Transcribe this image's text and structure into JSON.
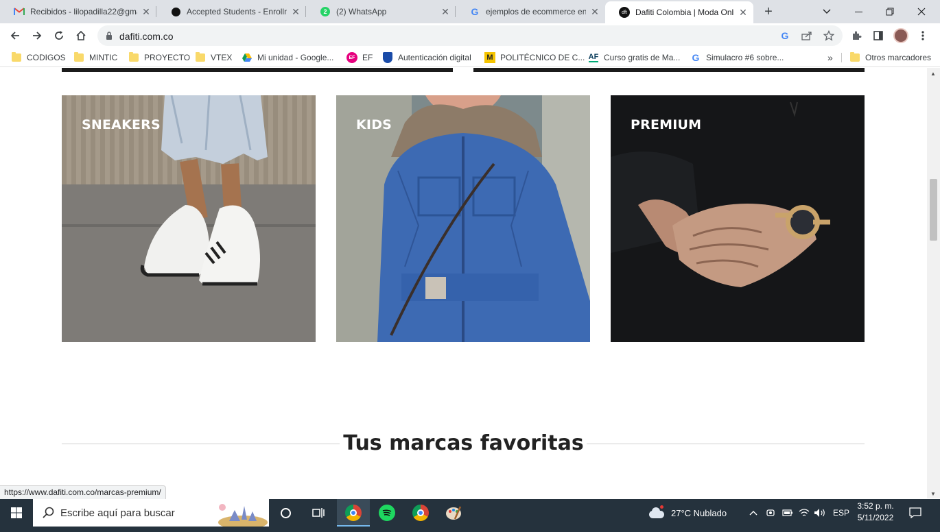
{
  "browser": {
    "tabs": [
      {
        "title": "Recibidos - lilopadilla22@gmail.com",
        "icon": "gmail-icon"
      },
      {
        "title": "Accepted Students - Enrollment",
        "icon": "dot-icon"
      },
      {
        "title": "(2) WhatsApp",
        "icon": "whatsapp-icon"
      },
      {
        "title": "ejemplos de ecommerce en colombia",
        "icon": "google-icon"
      },
      {
        "title": "Dafiti Colombia | Moda Online",
        "icon": "dafiti-icon"
      }
    ],
    "active_tab": 4,
    "url": "dafiti.com.co",
    "bookmarks": [
      {
        "label": "CODIGOS",
        "icon": "folder-icon"
      },
      {
        "label": "MINTIC",
        "icon": "folder-icon"
      },
      {
        "label": "PROYECTO",
        "icon": "folder-icon"
      },
      {
        "label": "VTEX",
        "icon": "folder-icon"
      },
      {
        "label": "Mi unidad - Google...",
        "icon": "google-drive-icon"
      },
      {
        "label": "EF",
        "icon": "ef-icon"
      },
      {
        "label": "Autenticación digital",
        "icon": "shield-icon"
      },
      {
        "label": "POLITÉCNICO DE C...",
        "icon": "m-icon"
      },
      {
        "label": "Curso gratis de Ma...",
        "icon": "af-icon"
      },
      {
        "label": "Simulacro #6 sobre...",
        "icon": "google-icon"
      }
    ],
    "bookmarks_overflow": "»",
    "other_bookmarks": "Otros marcadores",
    "status_url": "https://www.dafiti.com.co/marcas-premium/"
  },
  "page": {
    "categories": [
      {
        "label": "SNEAKERS"
      },
      {
        "label": "KIDS"
      },
      {
        "label": "PREMIUM"
      }
    ],
    "section_title": "Tus marcas favoritas"
  },
  "taskbar": {
    "search_placeholder": "Escribe aquí para buscar",
    "weather": "27°C  Nublado",
    "language": "ESP",
    "time": "3:52 p. m.",
    "date": "5/11/2022"
  },
  "colors": {
    "tabbar": "#dee1e6",
    "taskbar": "#25323d",
    "accent_blue": "#1a73e8"
  }
}
